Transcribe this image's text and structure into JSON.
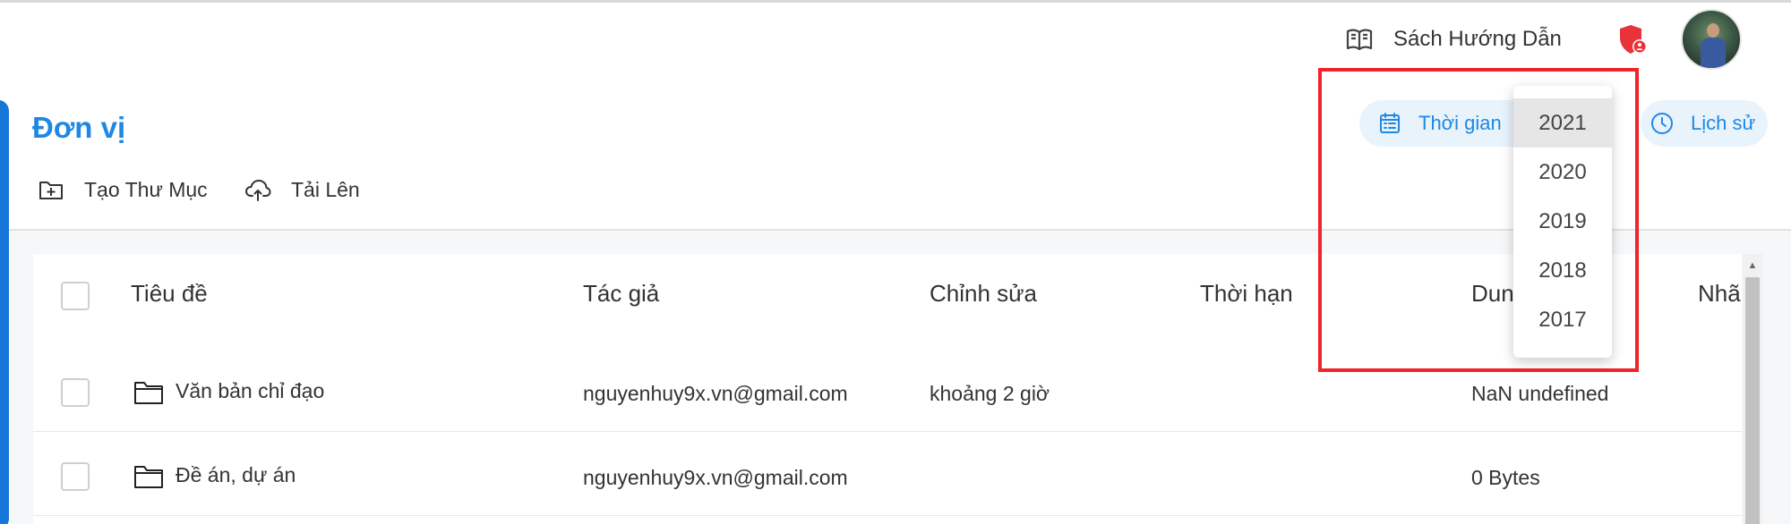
{
  "header": {
    "guide_label": "Sách Hướng Dẫn"
  },
  "page": {
    "title": "Đơn vị",
    "actions": {
      "create_folder": "Tạo Thư Mục",
      "upload": "Tải Lên"
    }
  },
  "filters": {
    "time_label": "Thời gian",
    "history_label": "Lịch sử"
  },
  "year_dropdown": {
    "options": [
      "2021",
      "2020",
      "2019",
      "2018",
      "2017"
    ],
    "selected": "2021"
  },
  "table": {
    "columns": [
      "Tiêu đề",
      "Tác giả",
      "Chỉnh sửa",
      "Thời hạn",
      "Dun",
      "Nhã"
    ],
    "rows": [
      {
        "title": "Văn bản chỉ đạo",
        "author": "nguyenhuy9x.vn@gmail.com",
        "edited": "khoảng 2 giờ",
        "deadline": "",
        "size": "NaN undefined"
      },
      {
        "title": "Đề án, dự án",
        "author": "nguyenhuy9x.vn@gmail.com",
        "edited": "",
        "deadline": "",
        "size": "0 Bytes"
      }
    ]
  },
  "colors": {
    "accent": "#1e88e5",
    "highlight": "#f0242a",
    "left_accent": "#1677d9"
  },
  "icons": {
    "guide": "book-icon",
    "security": "shield-icon",
    "create_folder": "folder-plus-icon",
    "upload": "cloud-upload-icon",
    "time": "calendar-icon",
    "history": "clock-icon",
    "row": "folder-icon"
  }
}
